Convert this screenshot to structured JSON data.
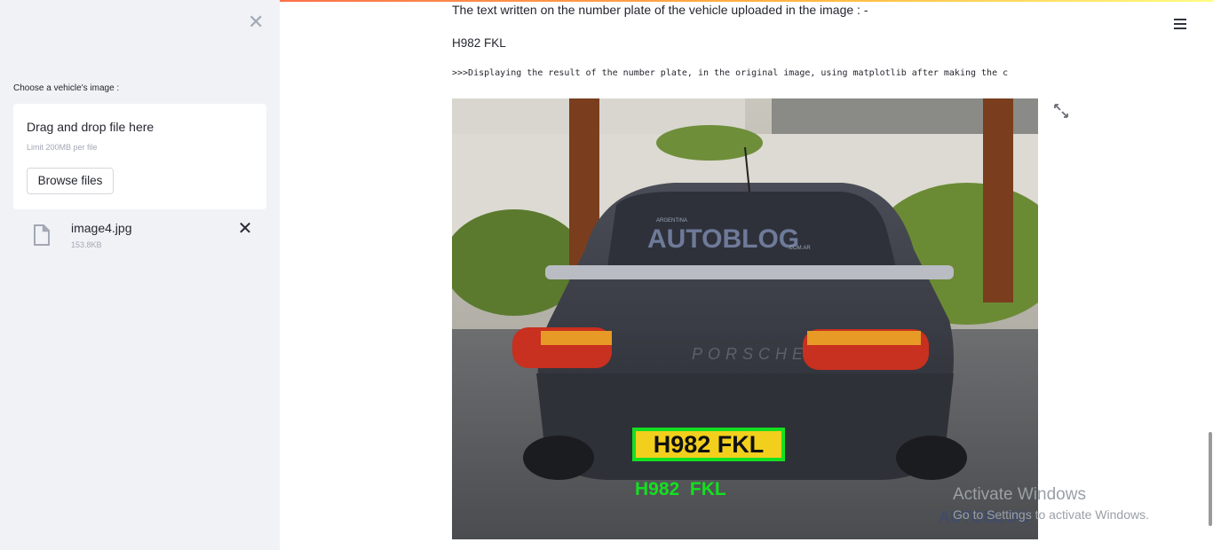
{
  "sidebar": {
    "close_icon": "close-icon",
    "uploader_label": "Choose a vehicle's image :",
    "dropzone_title": "Drag and drop file here",
    "dropzone_limit": "Limit 200MB per file",
    "browse_label": "Browse files",
    "file": {
      "name": "image4.jpg",
      "size": "153.8KB",
      "icon": "file-icon",
      "remove_icon": "close-icon"
    }
  },
  "main": {
    "result_heading": "The text written on the number plate of the vehicle uploaded in the image : -",
    "plate_value": "H982 FKL",
    "console_line": ">>>Displaying the result of the number plate, in the original image,  using matplotlib after making the c",
    "menu_icon": "hamburger-icon",
    "expand_icon": "fullscreen-icon",
    "image": {
      "watermark_small": "ARGENTINA",
      "watermark_logo": "AUTOBLOG",
      "watermark_domain": ".COM.AR",
      "car_badge": "PORSCHE",
      "plate_text": "H982 FKL",
      "ocr_overlay": "H982  FKL",
      "corner_logo": "AUTOBLOG"
    }
  },
  "os_watermark": {
    "title": "Activate Windows",
    "subtitle": "Go to Settings to activate Windows."
  },
  "colors": {
    "sidebar_bg": "#f0f2f6",
    "plate_yellow": "#f2cf1d",
    "detection_green": "#14e020"
  }
}
